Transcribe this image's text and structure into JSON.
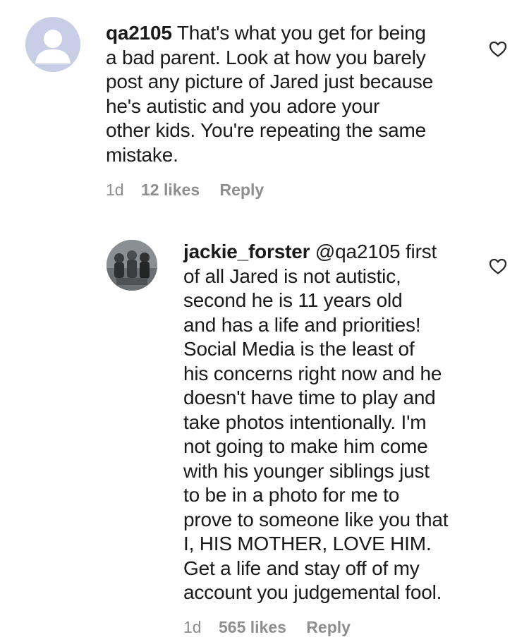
{
  "comments": [
    {
      "username": "qa2105",
      "lines": [
        "That's what you get for being",
        "a bad parent. Look at how you barely",
        "post any picture of Jared just because",
        "he's autistic and you adore your",
        "other kids. You're repeating the same",
        "mistake."
      ],
      "time": "1d",
      "likes": "12 likes",
      "reply": "Reply",
      "avatar_icon": "default-user-avatar-icon",
      "like_icon": "heart-outline-icon"
    },
    {
      "username": "jackie_forster",
      "mention": "@qa2105",
      "lines": [
        "first",
        "of all Jared is not autistic,",
        "second he is 11 years old",
        "and has a life and priorities!",
        "Social Media is the least of",
        "his concerns right now and he",
        "doesn't have time to play and",
        "take photos intentionally. I'm",
        "not going to make him come",
        "with his younger siblings just",
        "to be in a photo for me to",
        "prove to someone like you that",
        "I, HIS MOTHER, LOVE HIM.",
        "Get a life and stay off of my",
        "account you judgemental fool."
      ],
      "time": "1d",
      "likes": "565 likes",
      "reply": "Reply",
      "avatar_icon": "profile-photo-avatar",
      "like_icon": "heart-outline-icon"
    }
  ],
  "colors": {
    "text": "#1a1a1a",
    "meta": "#8e8e8e",
    "default_avatar_bg": "#c7cee6",
    "default_avatar_fg": "#ffffff"
  }
}
